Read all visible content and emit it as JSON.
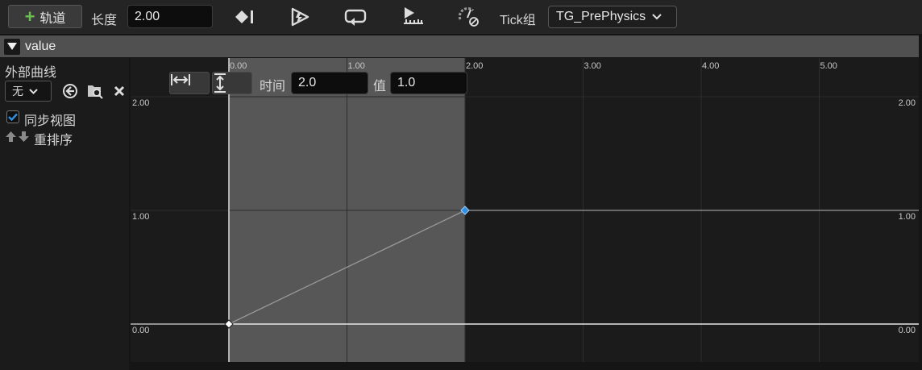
{
  "toolbar": {
    "add_track_label": "轨道",
    "length_label": "长度",
    "length_value": "2.00",
    "tick_group_label": "Tick组",
    "tick_group_value": "TG_PrePhysics"
  },
  "section": {
    "title": "value"
  },
  "left_panel": {
    "external_curve_label": "外部曲线",
    "external_curve_value": "无",
    "sync_view_label": "同步视图",
    "sync_view_checked": true,
    "reorder_label": "重排序"
  },
  "graph": {
    "time_label": "时间",
    "time_value": "2.0",
    "value_label": "值",
    "value_value": "1.0",
    "x_ticks": [
      "0.00",
      "1.00",
      "2.00",
      "3.00",
      "4.00",
      "5.00"
    ],
    "y_ticks": [
      "2.00",
      "1.00",
      "0.00"
    ],
    "keys": [
      {
        "time": 0.0,
        "value": 0.0
      },
      {
        "time": 2.0,
        "value": 1.0
      }
    ],
    "colors": {
      "selected_key": "#2f8fe0",
      "curve": "#9a9a9a",
      "active_range": "#575757"
    }
  }
}
